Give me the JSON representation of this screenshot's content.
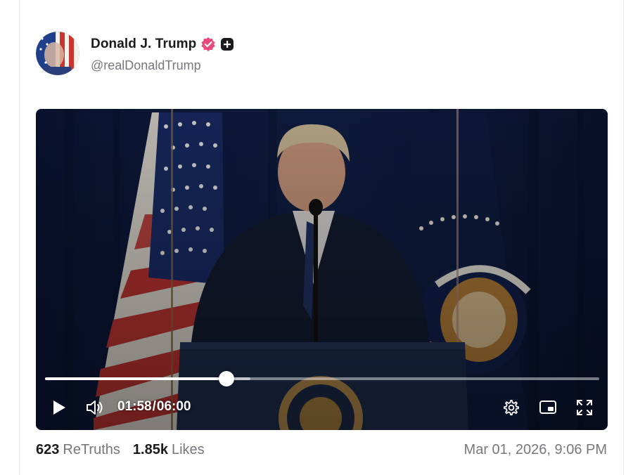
{
  "post": {
    "author": {
      "display_name": "Donald J. Trump",
      "handle": "@realDonaldTrump",
      "avatar_icon": "avatar-portrait",
      "verified_icon": "verified-badge-icon",
      "verified_color": "#e8497a"
    },
    "video": {
      "current_time": "01:58",
      "duration": "06:00",
      "separator": "/",
      "progress_fraction": 0.3278,
      "buffered_fraction": 0.37,
      "controls": {
        "play_icon": "play-icon",
        "volume_icon": "volume-icon",
        "settings_icon": "gear-icon",
        "pip_icon": "picture-in-picture-icon",
        "fullscreen_icon": "fullscreen-icon"
      }
    },
    "stats": {
      "retruths_count": "623",
      "retruths_label": "ReTruths",
      "likes_count": "1.85k",
      "likes_label": "Likes"
    },
    "timestamp": "Mar 01, 2026, 9:06 PM"
  },
  "colors": {
    "text_primary": "#1b1b1f",
    "text_secondary": "#77777f",
    "video_background": "#0a1535"
  }
}
